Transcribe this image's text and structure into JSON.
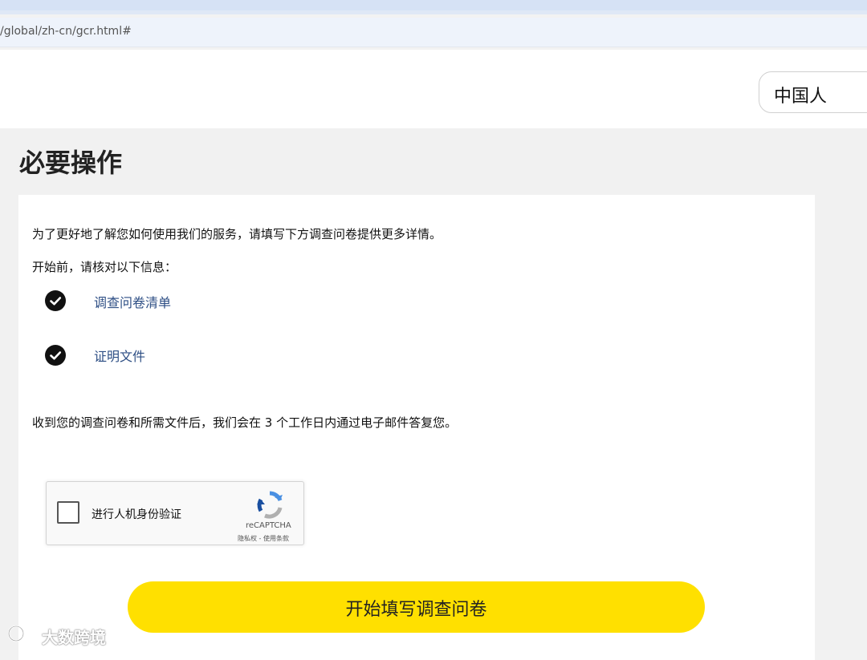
{
  "browser": {
    "url": "/global/zh-cn/gcr.html#"
  },
  "header": {
    "language_selected": "中国人"
  },
  "main": {
    "title": "必要操作",
    "intro": "为了更好地了解您如何使用我们的服务，请填写下方调查问卷提供更多详情。",
    "before_start": "开始前，请核对以下信息：",
    "checklist": [
      {
        "label": "调查问卷清单",
        "icon": "check-circle-icon"
      },
      {
        "label": "证明文件",
        "icon": "check-circle-icon"
      }
    ],
    "reply_note": "收到您的调查问卷和所需文件后，我们会在 3 个工作日内通过电子邮件答复您。",
    "recaptcha": {
      "label": "进行人机身份验证",
      "brand": "reCAPTCHA",
      "links": "隐私权 - 使用条款"
    },
    "cta_label": "开始填写调查问卷"
  },
  "watermark": {
    "text": "大数跨境"
  }
}
